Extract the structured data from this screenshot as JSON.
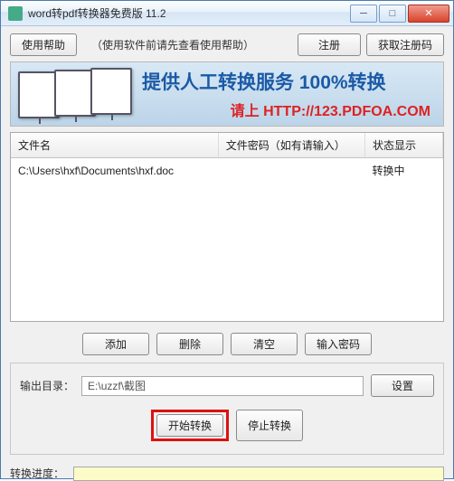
{
  "window": {
    "title": "word转pdf转换器免费版 11.2"
  },
  "toolbar": {
    "help_label": "使用帮助",
    "hint": "（使用软件前请先查看使用帮助）",
    "register_label": "注册",
    "getcode_label": "获取注册码"
  },
  "banner": {
    "title": "提供人工转换服务 100%转换",
    "subtitle_prefix": "请上 ",
    "subtitle_url": "HTTP://123.PDFOA.COM"
  },
  "table": {
    "headers": {
      "file": "文件名",
      "password": "文件密码（如有请输入）",
      "status": "状态显示"
    },
    "rows": [
      {
        "file": "C:\\Users\\hxf\\Documents\\hxf.doc",
        "password": "",
        "status": "转换中"
      }
    ]
  },
  "buttons": {
    "add": "添加",
    "delete": "删除",
    "clear": "清空",
    "input_password": "输入密码",
    "start": "开始转换",
    "stop": "停止转换",
    "settings": "设置"
  },
  "output": {
    "label": "输出目录：",
    "path": "E:\\uzzf\\截图"
  },
  "progress": {
    "label": "转换进度："
  }
}
